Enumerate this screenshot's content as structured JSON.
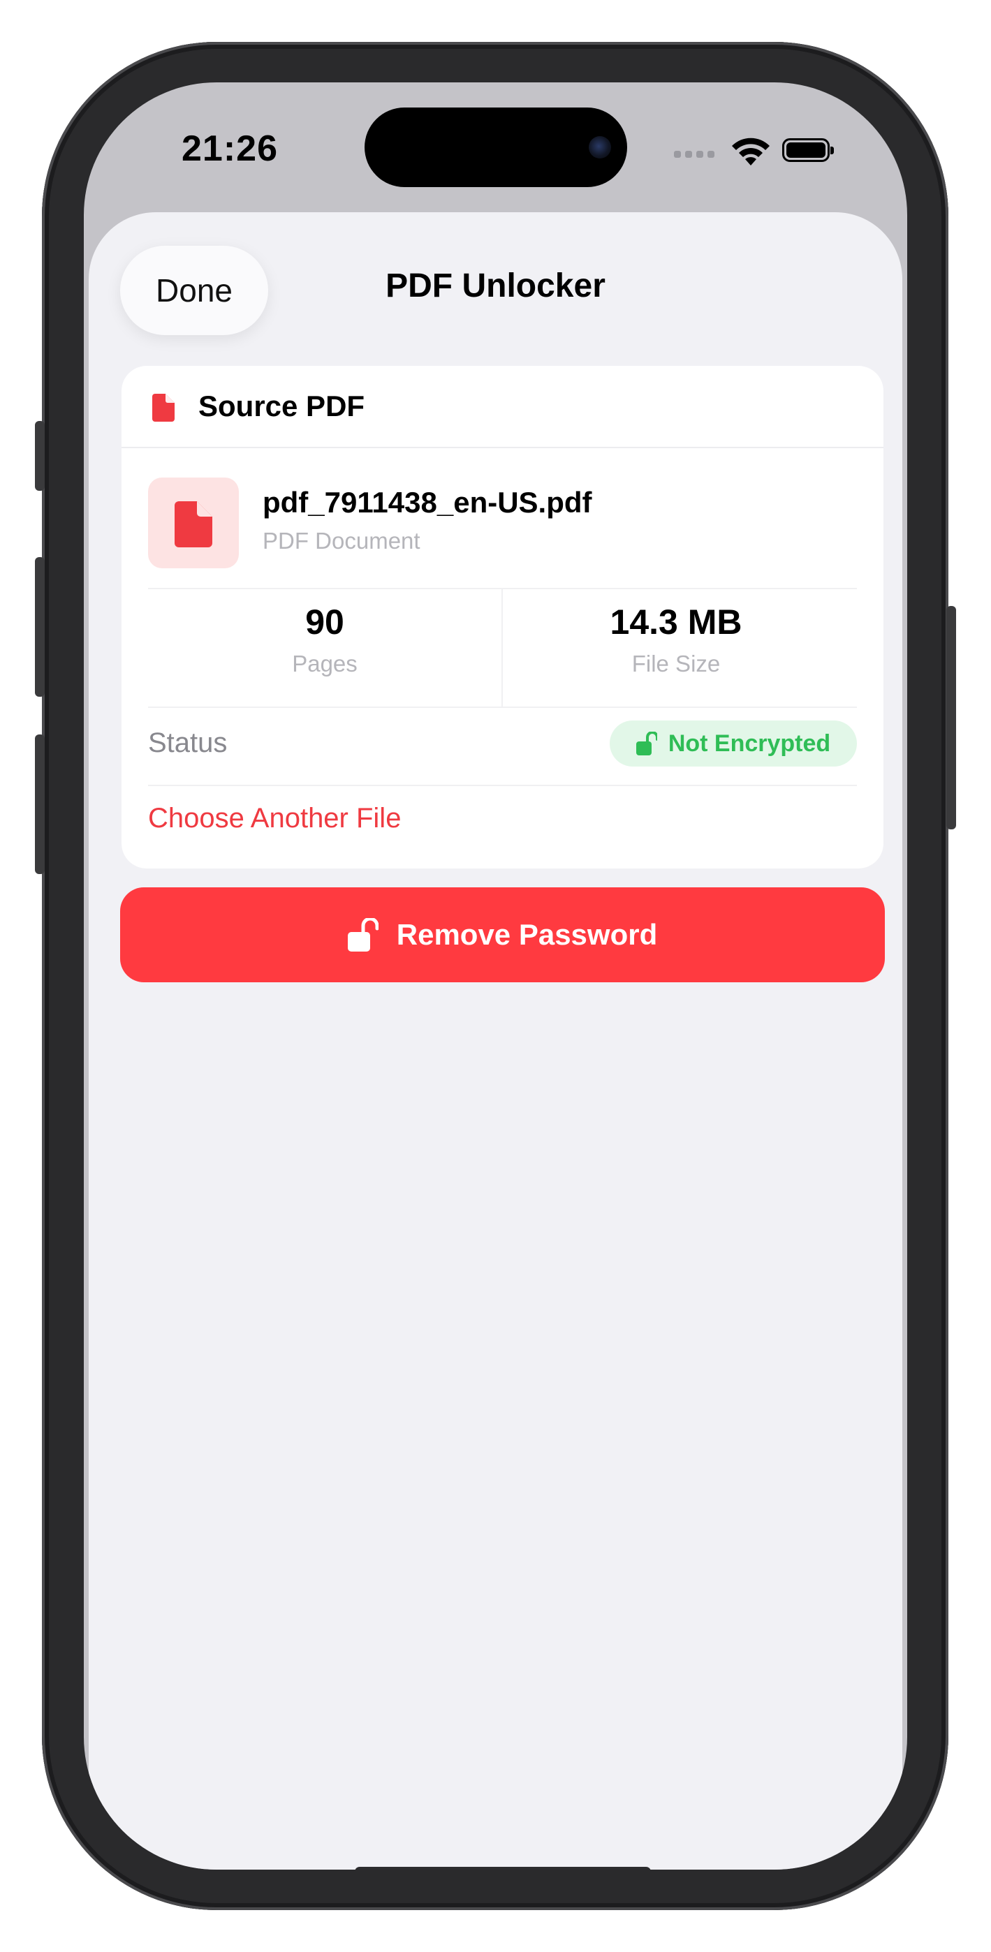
{
  "status_bar": {
    "time": "21:26",
    "icons": [
      "signal-icon",
      "wifi-icon",
      "battery-icon"
    ]
  },
  "nav": {
    "done_label": "Done",
    "title": "PDF Unlocker"
  },
  "source_card": {
    "section_title": "Source PDF",
    "file": {
      "name": "pdf_7911438_en-US.pdf",
      "type": "PDF Document"
    },
    "stats": [
      {
        "value": "90",
        "label": "Pages"
      },
      {
        "value": "14.3 MB",
        "label": "File Size"
      }
    ],
    "status": {
      "label": "Status",
      "badge": "Not Encrypted"
    },
    "choose_label": "Choose Another File"
  },
  "action": {
    "label": "Remove Password"
  },
  "colors": {
    "accent_red": "#ff3a40",
    "link_red": "#ef3a41",
    "success_green": "#2fbd56",
    "badge_green_bg": "#e2f7e8",
    "sheet_bg": "#f1f1f5"
  }
}
